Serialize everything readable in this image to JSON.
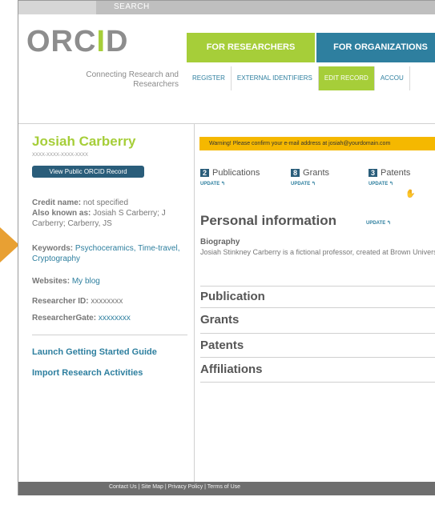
{
  "header": {
    "search_label": "SEARCH",
    "logo_main": "ORC",
    "logo_i": "I",
    "logo_d": "D",
    "tagline": "Connecting Research and Researchers",
    "tab_researchers": "FOR RESEARCHERS",
    "tab_organizations": "FOR ORGANIZATIONS",
    "subnav": [
      "REGISTER",
      "EXTERNAL IDENTIFIERS",
      "EDIT RECORD",
      "ACCOU"
    ]
  },
  "profile": {
    "name": "Josiah Carberry",
    "orcid_id": "XXXX-XXXX-XXXX-XXXX",
    "view_button": "View Public ORCID Record",
    "credit_label": "Credit name:",
    "credit_value": "not specified",
    "aka_label": "Also known as:",
    "aka_value": "Josiah S Carberry; J Carberry; Carberry, JS",
    "keywords_label": "Keywords:",
    "keywords_value": "Psychoceramics, Time-travel, Cryptography",
    "websites_label": "Websites:",
    "websites_value": "My blog",
    "researcher_id_label": "Researcher ID:",
    "researcher_id_value": "xxxxxxxx",
    "researchgate_label": "ResearcherGate:",
    "researchgate_value": "xxxxxxxx",
    "guide_link": "Launch Getting Started Guide",
    "import_link": "Import Research Activities"
  },
  "main": {
    "warning": "Warning! Please confirm your e-mail address at josiah@yourdomain.com",
    "counts": [
      {
        "num": "2",
        "label": "Publications",
        "update": "UPDATE ↰"
      },
      {
        "num": "8",
        "label": "Grants",
        "update": "UPDATE ↰"
      },
      {
        "num": "3",
        "label": "Patents",
        "update": "UPDATE ↰"
      }
    ],
    "personal_info": "Personal information",
    "personal_update": "UPDATE ↰",
    "biography_label": "Biography",
    "biography_text": "Josiah Stinkney Carberry is a fictional professor, created at Brown University, and to be known for his work in \"psychoceramics\"",
    "sections": [
      "Publication",
      "Grants",
      "Patents",
      "Affiliations"
    ]
  },
  "footer": {
    "links": "Contact Us  |  Site Map  |  Privacy Policy  |  Terms of Use"
  },
  "colors": {
    "green": "#a6ce39",
    "blue": "#2e7f9f",
    "warning": "#f5b800",
    "arrow": "#e8a033"
  }
}
